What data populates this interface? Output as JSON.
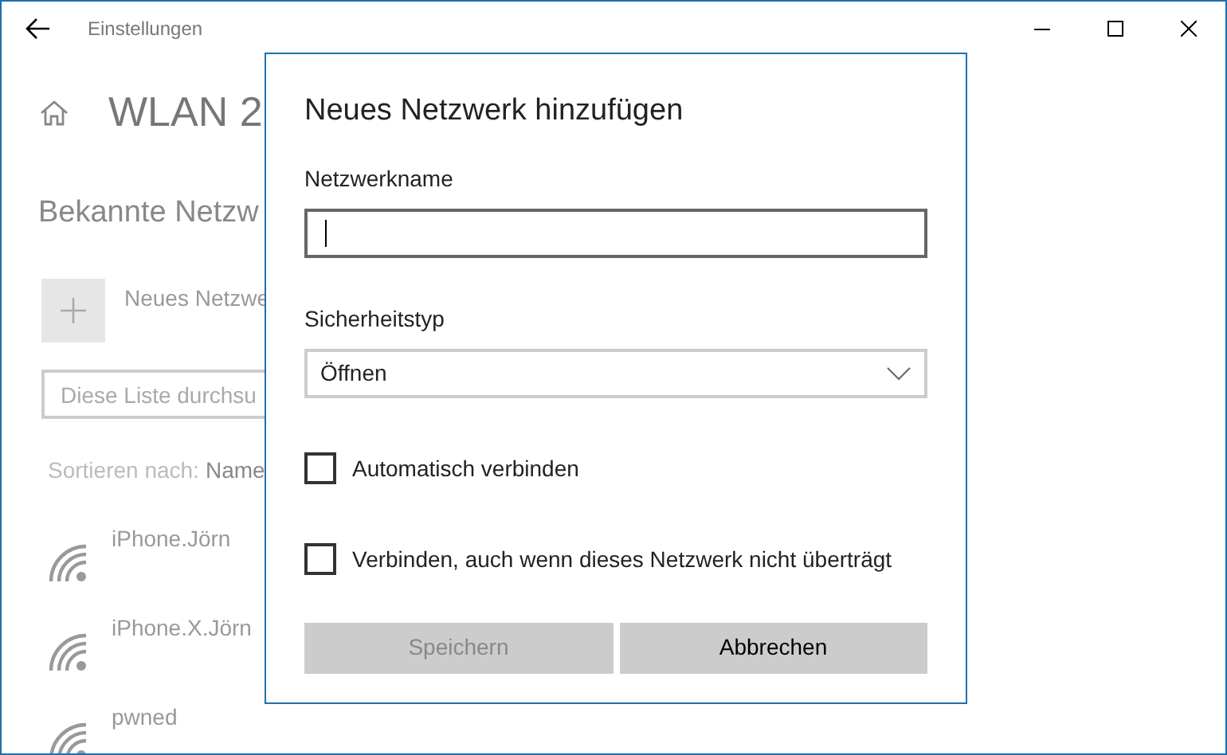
{
  "window": {
    "title": "Einstellungen"
  },
  "page": {
    "title": "WLAN 2",
    "section": "Bekannte Netzw",
    "add_label": "Neues Netzwe",
    "search": {
      "placeholder": "Diese Liste durchsu"
    },
    "sort_label": "Sortieren nach:",
    "sort_value": "Name",
    "networks": [
      {
        "name": "iPhone.Jörn"
      },
      {
        "name": "iPhone.X.Jörn"
      },
      {
        "name": "pwned"
      }
    ]
  },
  "dialog": {
    "title": "Neues Netzwerk hinzufügen",
    "name_field": {
      "label": "Netzwerkname",
      "focused": true
    },
    "security": {
      "label": "Sicherheitstyp",
      "value": "Öffnen"
    },
    "checkboxes": [
      {
        "label": "Automatisch verbinden",
        "checked": false
      },
      {
        "label": "Verbinden, auch wenn dieses Netzwerk nicht überträgt",
        "checked": false
      }
    ],
    "buttons": [
      {
        "label": "Speichern",
        "disabled": true
      },
      {
        "label": "Abbrechen",
        "disabled": false
      }
    ]
  }
}
